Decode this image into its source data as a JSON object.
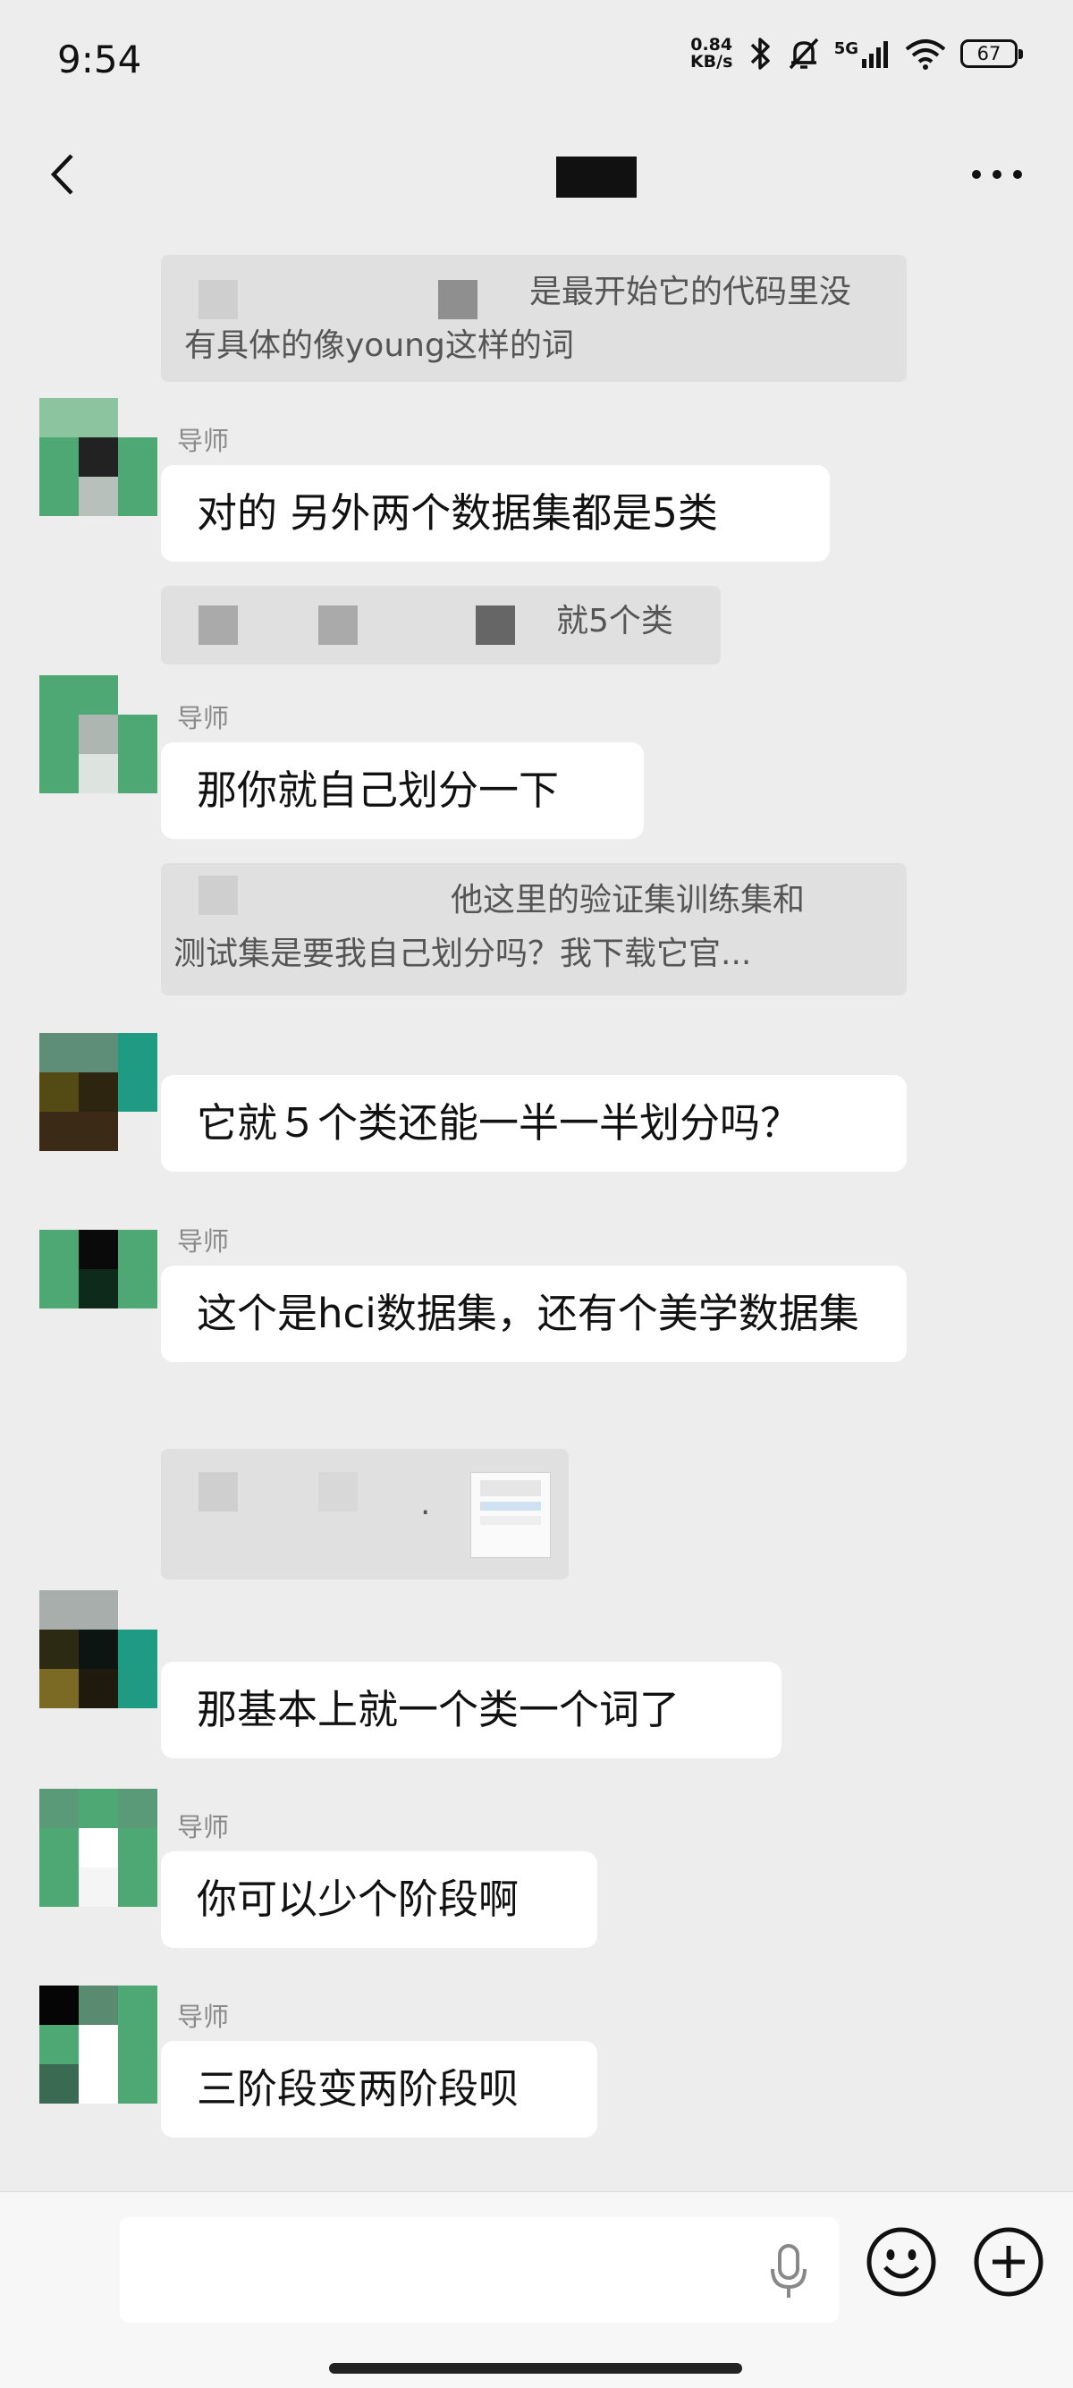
{
  "status_bar": {
    "time": "9:54",
    "net_speed_value": "0.84",
    "net_speed_unit": "KB/s",
    "signal_label": "5G",
    "battery": "67"
  },
  "header": {
    "title": ""
  },
  "messages": [
    {
      "kind": "quote",
      "lines": [
        "是最开始它的代码里没",
        "有具体的像young这样的词"
      ]
    },
    {
      "kind": "bubble",
      "sender": "导师",
      "text": "对的 另外两个数据集都是5类"
    },
    {
      "kind": "quote",
      "lines": [
        "就5个类"
      ]
    },
    {
      "kind": "bubble",
      "sender": "导师",
      "text": "那你就自己划分一下"
    },
    {
      "kind": "quote",
      "lines": [
        "他这里的验证集训练集和",
        "测试集是要我自己划分吗？我下载它官..."
      ]
    },
    {
      "kind": "bubble",
      "sender": "",
      "text": "它就５个类还能一半一半划分吗？"
    },
    {
      "kind": "bubble",
      "sender": "导师",
      "text": "这个是hci数据集，还有个美学数据集"
    },
    {
      "kind": "quote",
      "lines": [
        "."
      ]
    },
    {
      "kind": "bubble",
      "sender": "",
      "text": "那基本上就一个类一个词了"
    },
    {
      "kind": "bubble",
      "sender": "导师",
      "text": "你可以少个阶段啊"
    },
    {
      "kind": "bubble",
      "sender": "导师",
      "text": "三阶段变两阶段呗"
    }
  ],
  "input": {
    "placeholder": ""
  },
  "icons": {
    "back": "chevron-left-icon",
    "more": "more-dots-icon",
    "mic": "microphone-icon",
    "emoji": "smiley-face-icon",
    "plus": "plus-circle-icon",
    "bluetooth": "bluetooth-icon",
    "mute": "bell-off-icon",
    "wifi": "wifi-icon"
  },
  "colors": {
    "background": "#ededed",
    "bubble": "#ffffff",
    "quote": "#e0e0e0",
    "avatar_green": "#4ea873"
  }
}
